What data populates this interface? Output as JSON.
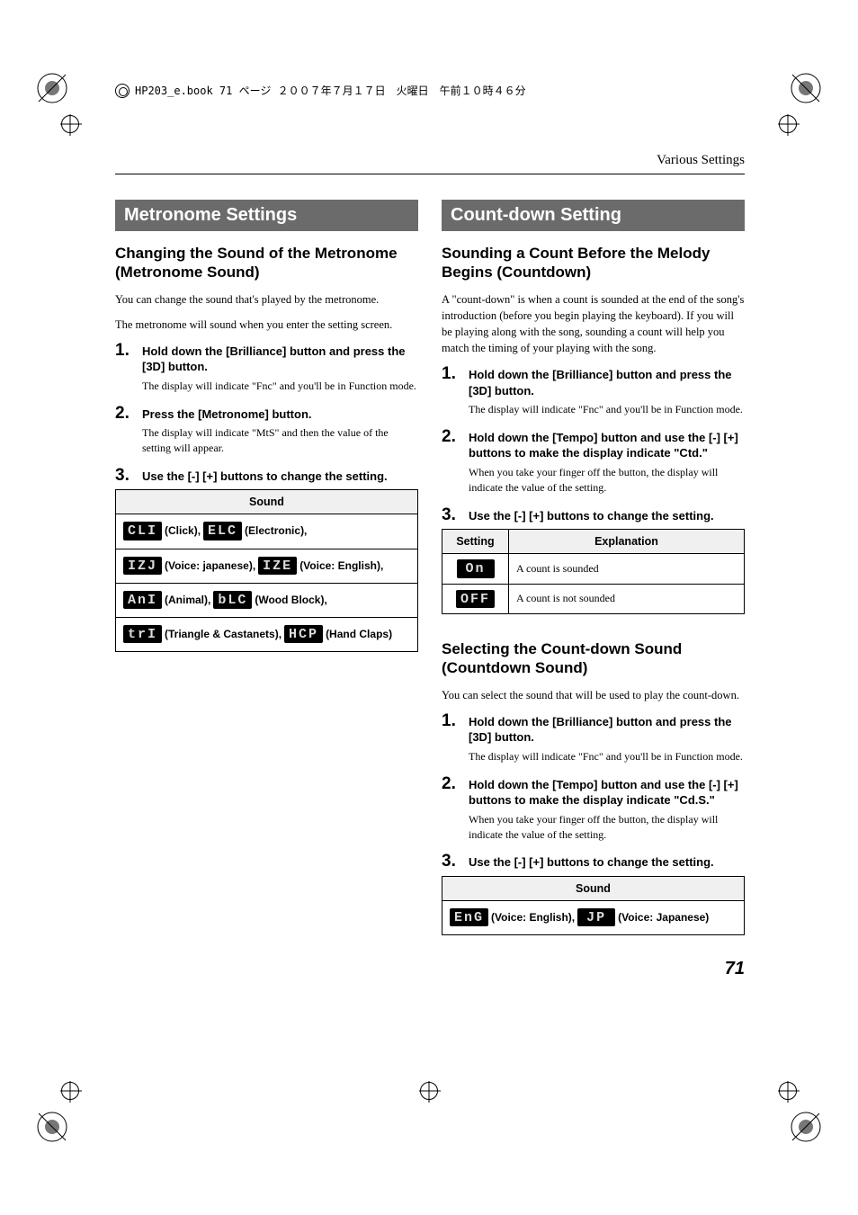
{
  "print_header": "HP203_e.book 71 ページ ２００７年７月１７日　火曜日　午前１０時４６分",
  "running_head": "Various Settings",
  "page_number": "71",
  "left": {
    "section_title": "Metronome Settings",
    "subhead": "Changing the Sound of the Metronome (Metronome Sound)",
    "intro1": "You can change the sound that's played by the metronome.",
    "intro2": "The metronome will sound when you enter the setting screen.",
    "step1_num": "1.",
    "step1_bold": "Hold down the [Brilliance] button and press the [3D] button.",
    "step1_note": "The display will indicate \"Fnc\" and you'll be in Function mode.",
    "step2_num": "2.",
    "step2_bold": "Press the [Metronome] button.",
    "step2_note": "The display will indicate \"MtS\" and then the value of the setting will appear.",
    "step3_num": "3.",
    "step3_bold": "Use the [-] [+] buttons to change the setting.",
    "table_header": "Sound",
    "sounds": [
      {
        "code": "CLI",
        "label": "(Click),"
      },
      {
        "code": "ELC",
        "label": "(Electronic),"
      },
      {
        "code": "IZJ",
        "label": "(Voice: japanese),"
      },
      {
        "code": "IZE",
        "label": "(Voice: English),"
      },
      {
        "code": "AnI",
        "label": "(Animal),"
      },
      {
        "code": "bLC",
        "label": "(Wood Block),"
      },
      {
        "code": "trI",
        "label": "(Triangle & Castanets),"
      },
      {
        "code": "HCP",
        "label": "(Hand Claps)"
      }
    ]
  },
  "right": {
    "section_title": "Count-down Setting",
    "subhead1": "Sounding a Count Before the Melody Begins (Countdown)",
    "intro1": "A \"count-down\" is when a count is sounded at the end of the song's introduction (before you begin playing the keyboard). If you will be playing along with the song, sounding a count will help you match the timing of your playing with the song.",
    "s1a_num": "1.",
    "s1a_bold": "Hold down the [Brilliance] button and press the [3D] button.",
    "s1a_note": "The display will indicate \"Fnc\" and you'll be in Function mode.",
    "s1b_num": "2.",
    "s1b_bold": "Hold down the [Tempo] button and use the [-] [+] buttons to make the display indicate \"Ctd.\"",
    "s1b_note": "When you take your finger off the button, the display will indicate the value of the setting.",
    "s1c_num": "3.",
    "s1c_bold": "Use the [-] [+] buttons to change the setting.",
    "table1_h1": "Setting",
    "table1_h2": "Explanation",
    "table1_rows": [
      {
        "code": "On",
        "text": "A count is sounded"
      },
      {
        "code": "OFF",
        "text": "A count is not sounded"
      }
    ],
    "subhead2": "Selecting the Count-down Sound (Countdown Sound)",
    "intro2": "You can select the sound that will be used to play the count-down.",
    "s2a_num": "1.",
    "s2a_bold": "Hold down the [Brilliance] button and press the [3D] button.",
    "s2a_note": "The display will indicate \"Fnc\" and you'll be in Function mode.",
    "s2b_num": "2.",
    "s2b_bold": "Hold down the [Tempo] button and use the [-] [+] buttons to make the display indicate \"Cd.S.\"",
    "s2b_note": "When you take your finger off the button, the display will indicate the value of the setting.",
    "s2c_num": "3.",
    "s2c_bold": "Use the [-] [+] buttons to change the setting.",
    "table2_header": "Sound",
    "table2_sounds": [
      {
        "code": "EnG",
        "label": "(Voice: English),"
      },
      {
        "code": " JP",
        "label": "(Voice: Japanese)"
      }
    ]
  }
}
